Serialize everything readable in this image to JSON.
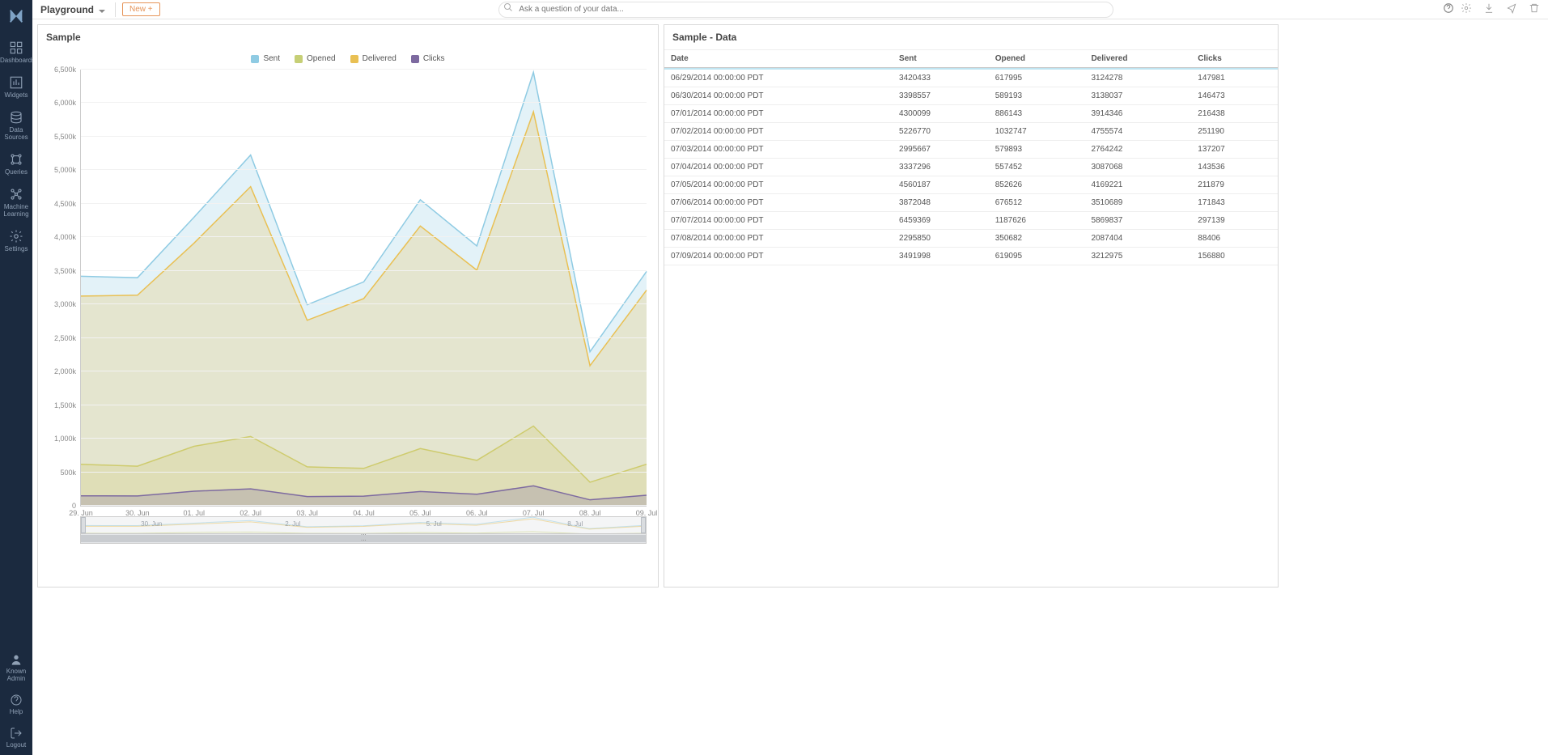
{
  "sidebar": {
    "items": [
      {
        "label": "Dashboards"
      },
      {
        "label": "Widgets"
      },
      {
        "label": "Data Sources"
      },
      {
        "label": "Queries"
      },
      {
        "label": "Machine Learning"
      },
      {
        "label": "Settings"
      }
    ],
    "footer": [
      {
        "label": "Known Admin"
      },
      {
        "label": "Help"
      },
      {
        "label": "Logout"
      }
    ]
  },
  "header": {
    "page_name": "Playground",
    "new_button": "New +",
    "search_placeholder": "Ask a question of your data..."
  },
  "panels": {
    "chart_title": "Sample",
    "table_title": "Sample - Data"
  },
  "chart_data": {
    "type": "area",
    "title": "Sample",
    "xlabel": "",
    "ylabel": "",
    "ylim": [
      0,
      6500000
    ],
    "ytick_labels": [
      "0",
      "500k",
      "1,000k",
      "1,500k",
      "2,000k",
      "2,500k",
      "3,000k",
      "3,500k",
      "4,000k",
      "4,500k",
      "5,000k",
      "5,500k",
      "6,000k",
      "6,500k"
    ],
    "categories": [
      "29. Jun",
      "30. Jun",
      "01. Jul",
      "02. Jul",
      "03. Jul",
      "04. Jul",
      "05. Jul",
      "06. Jul",
      "07. Jul",
      "08. Jul",
      "09. Jul"
    ],
    "navigator_ticks": [
      "30. Jun",
      "2. Jul",
      "5. Jul",
      "8. Jul"
    ],
    "series": [
      {
        "name": "Sent",
        "color": "#8fcbe3",
        "values": [
          3420433,
          3398557,
          4300099,
          5226770,
          2995667,
          3337296,
          4560187,
          3872048,
          6459369,
          2295850,
          3491998
        ]
      },
      {
        "name": "Opened",
        "color": "#c6cf76",
        "values": [
          617995,
          589193,
          886143,
          1032747,
          579893,
          557452,
          852626,
          676512,
          1187626,
          350682,
          619095
        ]
      },
      {
        "name": "Delivered",
        "color": "#e9c053",
        "values": [
          3124278,
          3138037,
          3914346,
          4755574,
          2764242,
          3087068,
          4169221,
          3510689,
          5869837,
          2087404,
          3212975
        ]
      },
      {
        "name": "Clicks",
        "color": "#7d6aa0",
        "values": [
          147981,
          146473,
          216438,
          251190,
          137207,
          143536,
          211879,
          171843,
          297139,
          88406,
          156880
        ]
      }
    ]
  },
  "table": {
    "columns": [
      "Date",
      "Sent",
      "Opened",
      "Delivered",
      "Clicks"
    ],
    "rows": [
      [
        "06/29/2014 00:00:00 PDT",
        "3420433",
        "617995",
        "3124278",
        "147981"
      ],
      [
        "06/30/2014 00:00:00 PDT",
        "3398557",
        "589193",
        "3138037",
        "146473"
      ],
      [
        "07/01/2014 00:00:00 PDT",
        "4300099",
        "886143",
        "3914346",
        "216438"
      ],
      [
        "07/02/2014 00:00:00 PDT",
        "5226770",
        "1032747",
        "4755574",
        "251190"
      ],
      [
        "07/03/2014 00:00:00 PDT",
        "2995667",
        "579893",
        "2764242",
        "137207"
      ],
      [
        "07/04/2014 00:00:00 PDT",
        "3337296",
        "557452",
        "3087068",
        "143536"
      ],
      [
        "07/05/2014 00:00:00 PDT",
        "4560187",
        "852626",
        "4169221",
        "211879"
      ],
      [
        "07/06/2014 00:00:00 PDT",
        "3872048",
        "676512",
        "3510689",
        "171843"
      ],
      [
        "07/07/2014 00:00:00 PDT",
        "6459369",
        "1187626",
        "5869837",
        "297139"
      ],
      [
        "07/08/2014 00:00:00 PDT",
        "2295850",
        "350682",
        "2087404",
        "88406"
      ],
      [
        "07/09/2014 00:00:00 PDT",
        "3491998",
        "619095",
        "3212975",
        "156880"
      ]
    ]
  }
}
